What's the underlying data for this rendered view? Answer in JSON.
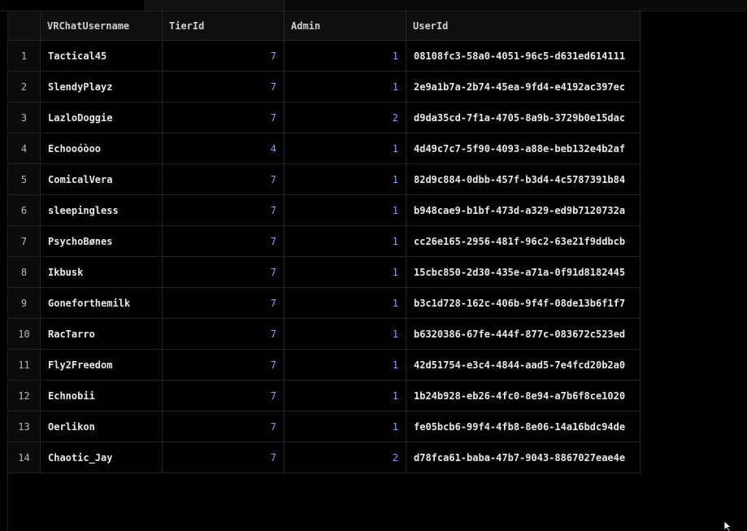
{
  "table": {
    "columns": [
      "VRChatUsername",
      "TierId",
      "Admin",
      "UserId"
    ],
    "rows": [
      {
        "index": "1",
        "username": "Tactical45",
        "tier": "7",
        "admin": "1",
        "user_id": "08108fc3-58a0-4051-96c5-d631ed614111"
      },
      {
        "index": "2",
        "username": "SlendyPlayz",
        "tier": "7",
        "admin": "1",
        "user_id": "2e9a1b7a-2b74-45ea-9fd4-e4192ac397ec"
      },
      {
        "index": "3",
        "username": "LazloDoggie",
        "tier": "7",
        "admin": "2",
        "user_id": "d9da35cd-7f1a-4705-8a9b-3729b0e15dac"
      },
      {
        "index": "4",
        "username": "Echooóòoo",
        "tier": "4",
        "admin": "1",
        "user_id": "4d49c7c7-5f90-4093-a88e-beb132e4b2af"
      },
      {
        "index": "5",
        "username": "ComicalVera",
        "tier": "7",
        "admin": "1",
        "user_id": "82d9c884-0dbb-457f-b3d4-4c5787391b84"
      },
      {
        "index": "6",
        "username": "sleepingless",
        "tier": "7",
        "admin": "1",
        "user_id": "b948cae9-b1bf-473d-a329-ed9b7120732a"
      },
      {
        "index": "7",
        "username": "PsychoBønes",
        "tier": "7",
        "admin": "1",
        "user_id": "cc26e165-2956-481f-96c2-63e21f9ddbcb"
      },
      {
        "index": "8",
        "username": "Ikbusk",
        "tier": "7",
        "admin": "1",
        "user_id": "15cbc850-2d30-435e-a71a-0f91d8182445"
      },
      {
        "index": "9",
        "username": "Goneforthemilk",
        "tier": "7",
        "admin": "1",
        "user_id": "b3c1d728-162c-406b-9f4f-08de13b6f1f7"
      },
      {
        "index": "10",
        "username": "RacTarro",
        "tier": "7",
        "admin": "1",
        "user_id": "b6320386-67fe-444f-877c-083672c523ed"
      },
      {
        "index": "11",
        "username": "Fly2Freedom",
        "tier": "7",
        "admin": "1",
        "user_id": "42d51754-e3c4-4844-aad5-7e4fcd20b2a0"
      },
      {
        "index": "12",
        "username": "Echnobii",
        "tier": "7",
        "admin": "1",
        "user_id": "1b24b928-eb26-4fc0-8e94-a7b6f8ce1020"
      },
      {
        "index": "13",
        "username": "Oerlikon",
        "tier": "7",
        "admin": "1",
        "user_id": "fe05bcb6-99f4-4fb8-8e06-14a16bdc94de"
      },
      {
        "index": "14",
        "username": "Chaotic_Jay",
        "tier": "7",
        "admin": "2",
        "user_id": "d78fca61-baba-47b7-9043-8867027eae4e"
      }
    ]
  },
  "colors": {
    "background": "#000000",
    "number_accent": "#7ea6f2",
    "grid_line": "#262626"
  },
  "icons": {
    "cursor": "mouse-pointer-icon"
  }
}
